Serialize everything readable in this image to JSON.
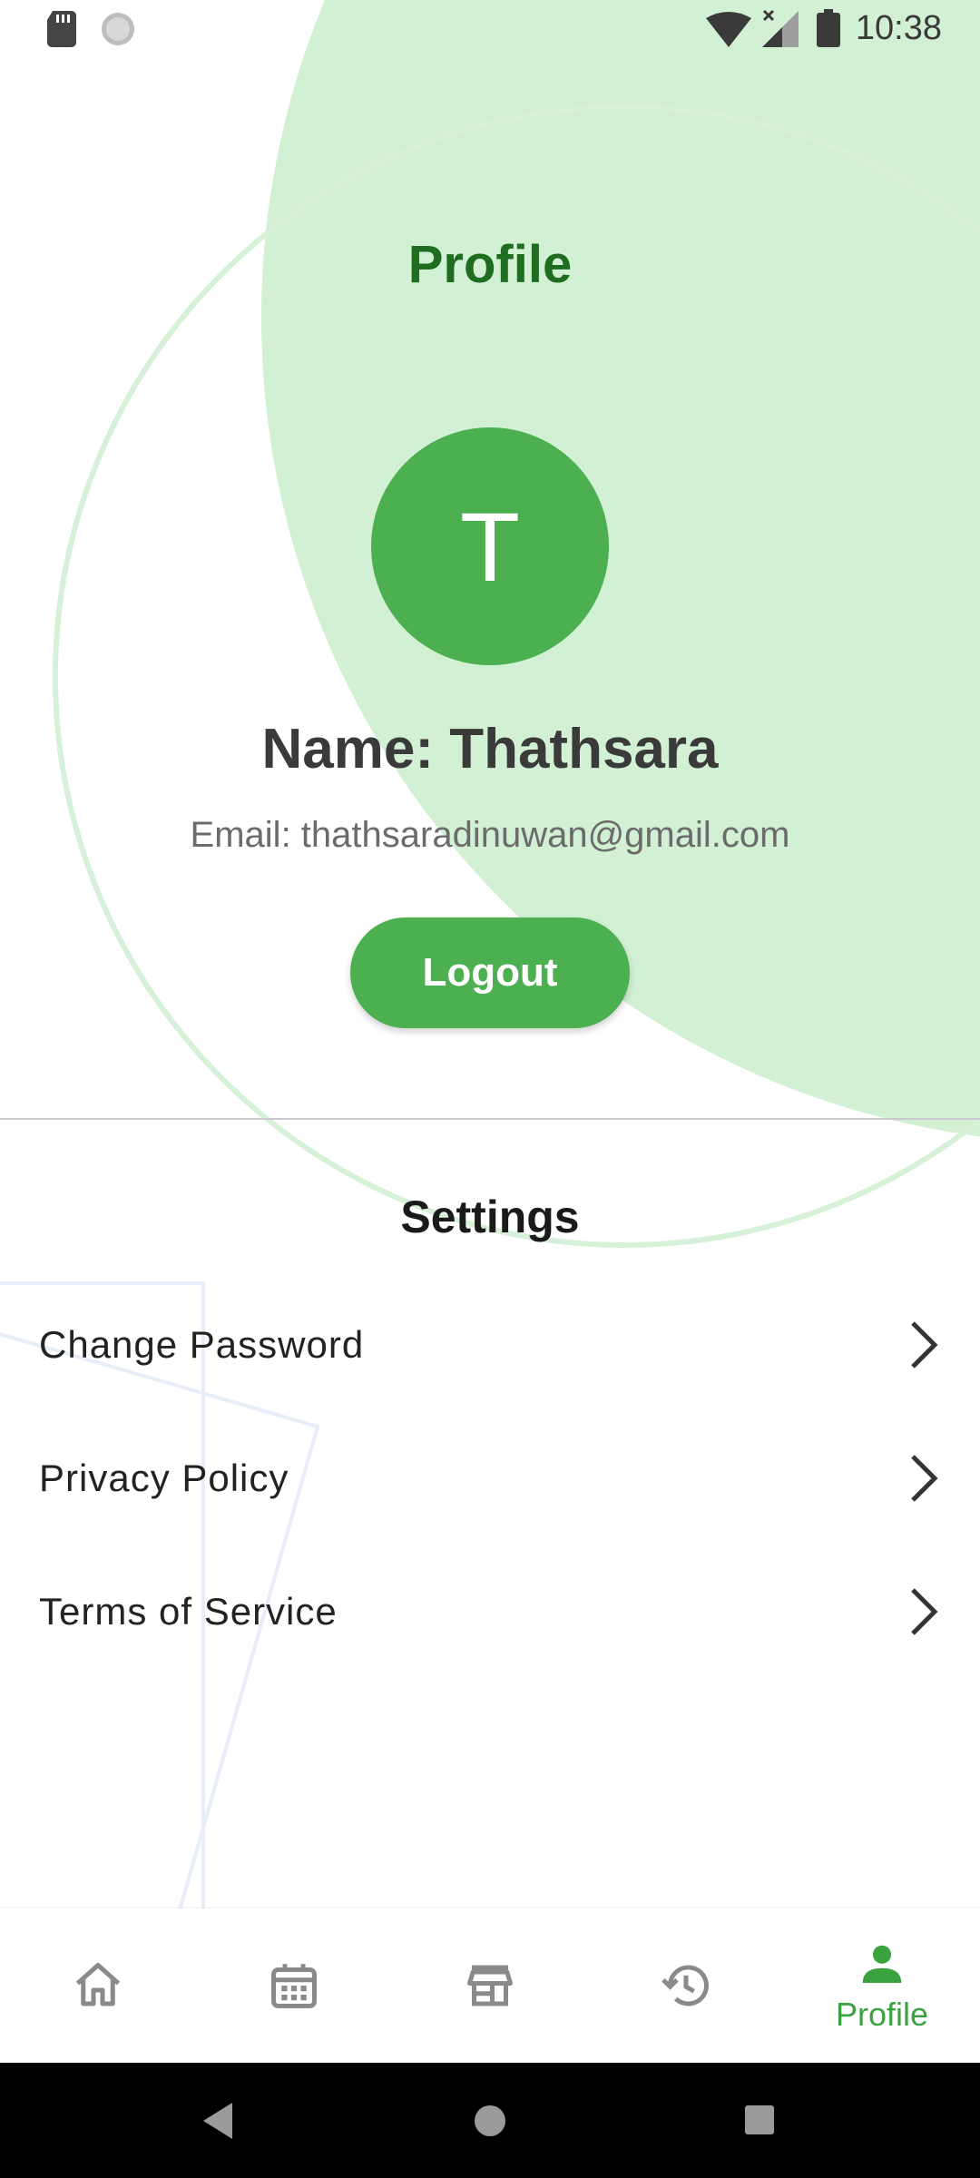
{
  "status_bar": {
    "time": "10:38"
  },
  "profile": {
    "title": "Profile",
    "avatar_initial": "T",
    "name_line": "Name: Thathsara",
    "email_line": "Email: thathsaradinuwan@gmail.com",
    "logout_label": "Logout"
  },
  "settings": {
    "title": "Settings",
    "items": [
      {
        "label": "Change Password"
      },
      {
        "label": "Privacy Policy"
      },
      {
        "label": "Terms of Service"
      }
    ]
  },
  "bottom_nav": {
    "items": [
      {
        "icon": "home-icon",
        "label": ""
      },
      {
        "icon": "calendar-icon",
        "label": ""
      },
      {
        "icon": "store-icon",
        "label": ""
      },
      {
        "icon": "history-icon",
        "label": ""
      },
      {
        "icon": "person-icon",
        "label": "Profile",
        "active": true
      }
    ]
  },
  "colors": {
    "primary": "#4caf50",
    "title_green": "#1f6d21",
    "decor_light_green": "#d2f0d4",
    "inactive_icon": "#8a8a8a"
  }
}
